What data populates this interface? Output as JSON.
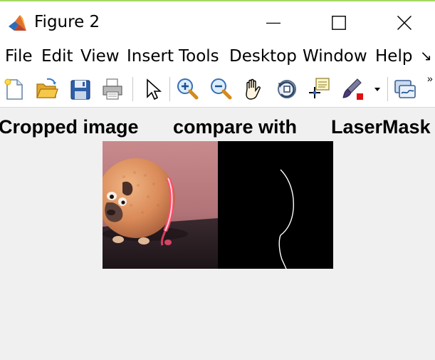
{
  "window": {
    "title": "Figure 2",
    "controls": [
      "minimize",
      "maximize",
      "close"
    ]
  },
  "menu": {
    "items": [
      "File",
      "Edit",
      "View",
      "Insert",
      "Tools",
      "Desktop",
      "Window",
      "Help"
    ],
    "overflow_glyph": "↘"
  },
  "toolbar": {
    "icons": [
      "new-figure-icon",
      "open-file-icon",
      "save-icon",
      "print-icon",
      "select-pointer-icon",
      "zoom-in-icon",
      "zoom-out-icon",
      "pan-hand-icon",
      "rotate-3d-icon",
      "data-cursor-icon",
      "brush-icon",
      "brush-dropdown-icon",
      "link-plot-icon"
    ],
    "overflow_glyph": "»"
  },
  "figure": {
    "titles": [
      "Cropped image",
      "compare with",
      "LaserMask"
    ]
  },
  "colors": {
    "window_background": "#f0f0f0",
    "titlebar": "#ffffff",
    "accent_line": "#a6d864",
    "mask_background": "#000000",
    "mask_line": "#ffffff",
    "laser": "#ff3b5c"
  }
}
